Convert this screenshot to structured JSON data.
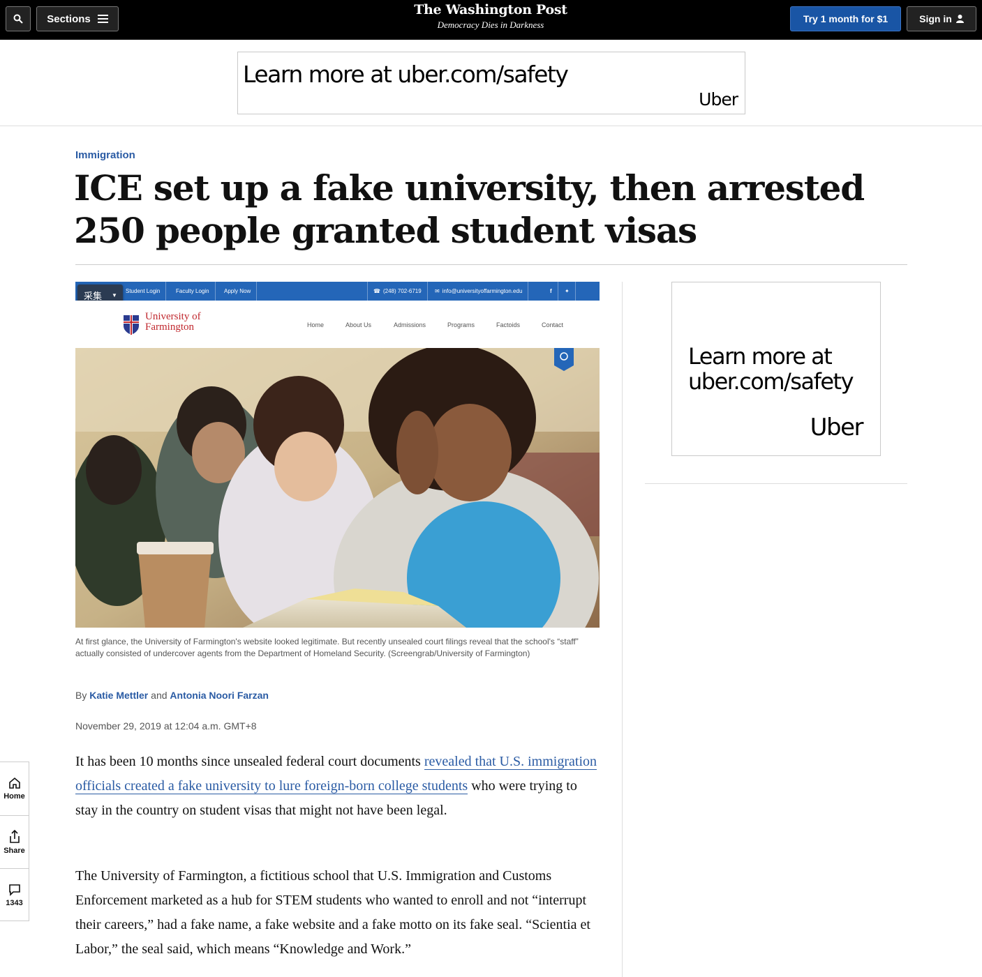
{
  "topbar": {
    "sections_label": "Sections",
    "logo": "The Washington Post",
    "tagline": "Democracy Dies in Darkness",
    "try_label": "Try 1 month for $1",
    "signin_label": "Sign in"
  },
  "top_ad": {
    "text": "Learn more at uber.com/safety",
    "brand": "Uber"
  },
  "article": {
    "kicker": "Immigration",
    "headline": "ICE set up a fake university, then arrested 250 people granted student visas",
    "figure": {
      "caiji": "采集",
      "nav": [
        "Student Login",
        "Faculty Login",
        "Apply Now"
      ],
      "phone": "(248) 702-6719",
      "email": "info@universityoffarmington.edu",
      "uni_name_1": "University of",
      "uni_name_2": "Farmington",
      "menu": [
        "Home",
        "About Us",
        "Admissions",
        "Programs",
        "Factoids",
        "Contact"
      ]
    },
    "caption": "At first glance, the University of Farmington's website looked legitimate. But recently unsealed court filings reveal that the school's “staff” actually consisted of undercover agents from the Department of Homeland Security. (Screengrab/University of Farmington)",
    "byline": {
      "by": "By",
      "author1": "Katie Mettler",
      "and": "and",
      "author2": "Antonia Noori Farzan"
    },
    "date": "November 29, 2019 at 12:04 a.m. GMT+8",
    "p1_start": "It has been 10 months since unsealed federal court documents ",
    "p1_link": "revealed that U.S. immigration officials created a fake university to lure foreign-born college students",
    "p1_end": " who were trying to stay in the country on student visas that might not have been legal.",
    "p2": "The University of Farmington, a fictitious school that U.S. Immigration and Customs Enforcement marketed as a hub for STEM students who wanted to enroll and not “interrupt their careers,” had a fake name, a fake website and a fake motto on its fake seal. “Scientia et Labor,” the seal said, which means “Knowledge and Work.”"
  },
  "side_ad": {
    "line1": "Learn more at",
    "line2": "uber.com/safety",
    "brand": "Uber"
  },
  "rail": {
    "home": "Home",
    "share": "Share",
    "comments": "1343"
  },
  "colors": {
    "accent": "#1955a5",
    "link": "#2a5ba4",
    "topbar": "#000000"
  }
}
